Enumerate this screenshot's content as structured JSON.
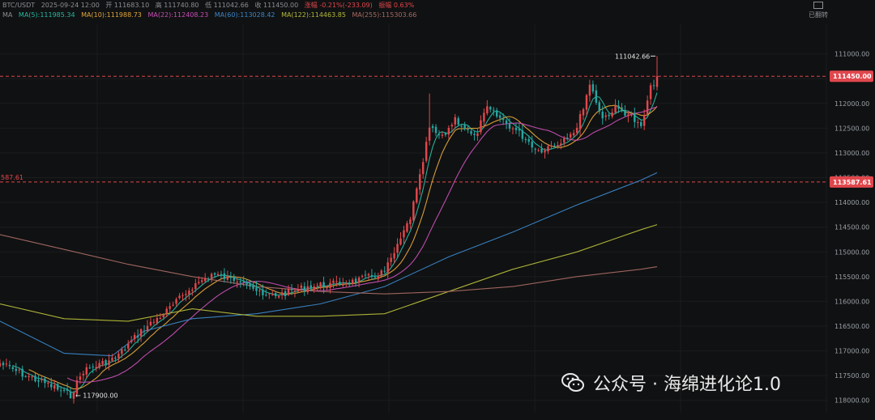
{
  "header": {
    "symbol": "BTC/USDT",
    "datetime": "2025-09-24 12:00",
    "open": "开 111683.10",
    "high": "高 111740.80",
    "low": "低 111042.66",
    "close": "收 111450.00",
    "change": "涨幅 -0.21%(-233.09)",
    "amplitude": "振幅 0.63%",
    "ma_toggle": "MA",
    "ma5": "MA(5):111985.34",
    "ma10": "MA(10):111988.73",
    "ma22": "MA(22):112408.23",
    "ma60": "MA(60):113028.42",
    "ma122": "MA(122):114463.85",
    "ma255": "MA(255):115303.66"
  },
  "controls": {
    "restore_label": "已翻转"
  },
  "colors": {
    "background": "#101112",
    "up": "#27a5a0",
    "down": "#e0474c",
    "ma5": "#26b8a1",
    "ma10": "#e0a53a",
    "ma22": "#c64fb5",
    "ma60": "#3a86c8",
    "ma122": "#b4ba3a",
    "ma255": "#a56a64",
    "price_line": "#e0474c",
    "grid": "#1b1c1e"
  },
  "watermark": "公众号 · 海绵进化论1.0",
  "chart_data": {
    "type": "candlestick",
    "inverted_price_axis": true,
    "ylim": [
      110400,
      118250
    ],
    "y_ticks": [
      "111000.00",
      "111500.00",
      "112000.00",
      "112500.00",
      "113000.00",
      "113500.00",
      "114000.00",
      "114500.00",
      "115000.00",
      "115500.00",
      "116000.00",
      "116500.00",
      "117000.00",
      "117500.00",
      "118000.00"
    ],
    "current_price_label": "111450.00",
    "current_price": 111450,
    "reference_price_label": "113587.61",
    "reference_left_label": "587.61",
    "reference_price": 113587.61,
    "extreme_low_label": "111042.66",
    "extreme_low_value": 111042.66,
    "extreme_high_label": "117900.00",
    "extreme_high_value": 117900,
    "anchors": [
      [
        0,
        117250
      ],
      [
        8,
        117500
      ],
      [
        14,
        117650
      ],
      [
        22,
        117900
      ],
      [
        26,
        117400
      ],
      [
        30,
        117300
      ],
      [
        36,
        117150
      ],
      [
        44,
        116600
      ],
      [
        52,
        116200
      ],
      [
        60,
        115700
      ],
      [
        66,
        115450
      ],
      [
        72,
        115550
      ],
      [
        76,
        115550
      ],
      [
        82,
        115900
      ],
      [
        88,
        115850
      ],
      [
        96,
        115700
      ],
      [
        104,
        115650
      ],
      [
        110,
        115600
      ],
      [
        116,
        115500
      ],
      [
        120,
        115400
      ],
      [
        124,
        114900
      ],
      [
        128,
        114300
      ],
      [
        131,
        113500
      ],
      [
        134,
        112500
      ],
      [
        138,
        112700
      ],
      [
        142,
        112300
      ],
      [
        148,
        112700
      ],
      [
        152,
        112100
      ],
      [
        156,
        112300
      ],
      [
        162,
        112600
      ],
      [
        168,
        112950
      ],
      [
        174,
        112800
      ],
      [
        180,
        112500
      ],
      [
        184,
        111600
      ],
      [
        188,
        112300
      ],
      [
        192,
        112100
      ],
      [
        196,
        112200
      ],
      [
        200,
        112500
      ],
      [
        203,
        111700
      ],
      [
        205,
        111450
      ]
    ],
    "series": [
      {
        "name": "MA(5)",
        "period": 5,
        "color": "#26b8a1"
      },
      {
        "name": "MA(10)",
        "period": 10,
        "color": "#e0a53a"
      },
      {
        "name": "MA(22)",
        "period": 22,
        "color": "#c64fb5"
      },
      {
        "name": "MA(60)",
        "period": 60,
        "color": "#3a86c8"
      },
      {
        "name": "MA(122)",
        "period": 122,
        "color": "#b4ba3a"
      },
      {
        "name": "MA(255)",
        "period": 255,
        "color": "#a56a64"
      }
    ],
    "long_ma_paths": {
      "MA(60)": [
        [
          0,
          116400
        ],
        [
          20,
          117050
        ],
        [
          35,
          117100
        ],
        [
          45,
          116600
        ],
        [
          60,
          116350
        ],
        [
          80,
          116250
        ],
        [
          100,
          116050
        ],
        [
          120,
          115700
        ],
        [
          140,
          115100
        ],
        [
          160,
          114600
        ],
        [
          180,
          114050
        ],
        [
          200,
          113550
        ],
        [
          205,
          113400
        ]
      ],
      "MA(122)": [
        [
          0,
          116050
        ],
        [
          20,
          116350
        ],
        [
          40,
          116400
        ],
        [
          60,
          116150
        ],
        [
          80,
          116300
        ],
        [
          100,
          116300
        ],
        [
          120,
          116250
        ],
        [
          140,
          115800
        ],
        [
          160,
          115350
        ],
        [
          180,
          115000
        ],
        [
          200,
          114550
        ],
        [
          205,
          114450
        ]
      ],
      "MA(255)": [
        [
          0,
          114650
        ],
        [
          20,
          114950
        ],
        [
          40,
          115250
        ],
        [
          60,
          115500
        ],
        [
          80,
          115700
        ],
        [
          100,
          115800
        ],
        [
          120,
          115850
        ],
        [
          140,
          115800
        ],
        [
          160,
          115700
        ],
        [
          180,
          115500
        ],
        [
          200,
          115350
        ],
        [
          205,
          115300
        ]
      ]
    }
  }
}
